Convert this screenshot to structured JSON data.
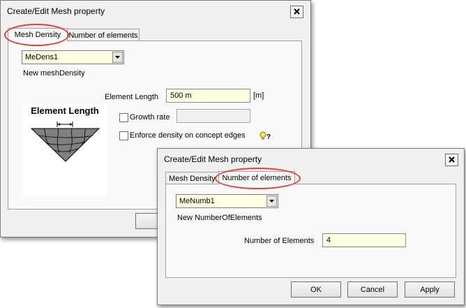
{
  "dialog1": {
    "title": "Create/Edit Mesh property",
    "tabs": [
      {
        "label": "Mesh Density",
        "active": true
      },
      {
        "label": "Number of elements",
        "active": false
      }
    ],
    "combo_value": "MeDens1",
    "subtitle": "New meshDensity",
    "element_length_label": "Element Length",
    "element_length_value": "500 m",
    "element_length_unit": "[m]",
    "figure_title": "Element Length",
    "growth_rate_label": "Growth rate",
    "growth_rate_checked": false,
    "growth_rate_value": "",
    "enforce_label": "Enforce density on concept edges",
    "enforce_checked": false,
    "help_icon": "lightbulb-question-icon"
  },
  "dialog2": {
    "title": "Create/Edit Mesh property",
    "tabs": [
      {
        "label": "Mesh Density",
        "active": false
      },
      {
        "label": "Number of elements",
        "active": true
      }
    ],
    "combo_value": "MeNumb1",
    "subtitle": "New NumberOfElements",
    "num_elements_label": "Number of Elements",
    "num_elements_value": "4",
    "buttons": {
      "ok": "OK",
      "cancel": "Cancel",
      "apply": "Apply"
    }
  },
  "colors": {
    "highlight": "#e2403a",
    "field_background": "#ffffe1",
    "dialog_background": "#f0f0f0"
  }
}
